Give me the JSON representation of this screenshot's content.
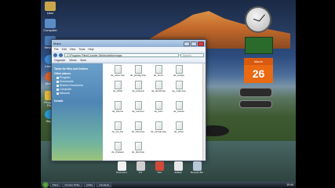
{
  "desktop": {
    "icons": [
      {
        "label": "User",
        "color": "#c9a64a"
      },
      {
        "label": "Computer",
        "color": "#5b8cc6"
      },
      {
        "label": "Network",
        "color": "#4a7ab4"
      },
      {
        "label": "Internet",
        "color": "#3c8ad6"
      },
      {
        "label": "Mozilla",
        "color": "#d8602a"
      },
      {
        "label": "Program Files",
        "color": "#e6b83c"
      },
      {
        "label": "Skype",
        "color": "#2a9ad6"
      }
    ]
  },
  "gadgets": {
    "calendar_day": "26",
    "calendar_month": "March"
  },
  "window": {
    "title": "Maps",
    "menu": [
      "File",
      "Edit",
      "View",
      "Tools",
      "Help"
    ],
    "address": "C:\\Program Files\\Counter-Strike\\cstrike\\maps",
    "search_placeholder": "Search",
    "toolbar": [
      "Organize",
      "Views",
      "Burn"
    ],
    "tasks": {
      "heading_file": "Tasks for files and folders",
      "heading_places": "Other places",
      "items": [
        "Program",
        "Documents",
        "Shared Documents",
        "Computer",
        "Network"
      ],
      "heading_details": "Details"
    },
    "files": [
      {
        "name": "de_aztec.bsp"
      },
      {
        "name": "de_prodigy.bsp"
      },
      {
        "name": "de_storm"
      },
      {
        "name": "de_vertigo"
      },
      {
        "name": "de_cbble"
      },
      {
        "name": "de_piranesi"
      },
      {
        "name": "de_dust2.bsp"
      },
      {
        "name": "de_nuke.bsp"
      },
      {
        "name": "de_inferno"
      },
      {
        "name": "de_survivor"
      },
      {
        "name": "de_train"
      },
      {
        "name": "de_tuscan"
      },
      {
        "name": "de_cpl_fire"
      },
      {
        "name": "de_train.bsp"
      },
      {
        "name": "de_vertigo.bsp"
      },
      {
        "name": "de_aztec"
      },
      {
        "name": "de_chateau"
      },
      {
        "name": "de_dust.bsp"
      }
    ]
  },
  "dock": [
    {
      "label": "Document",
      "color": "#f2f2f2"
    },
    {
      "label": "CS",
      "color": "#cfcfcf"
    },
    {
      "label": "Tool",
      "color": "#d04a3a"
    },
    {
      "label": "default",
      "color": "#e8e8e8"
    },
    {
      "label": "Recycle Bin",
      "color": "#b8c8d8"
    }
  ],
  "taskbar": {
    "tasks": [
      "Maps",
      "Counter-Strike",
      "cstrike",
      "Camtasia"
    ],
    "clock": "10:44"
  }
}
